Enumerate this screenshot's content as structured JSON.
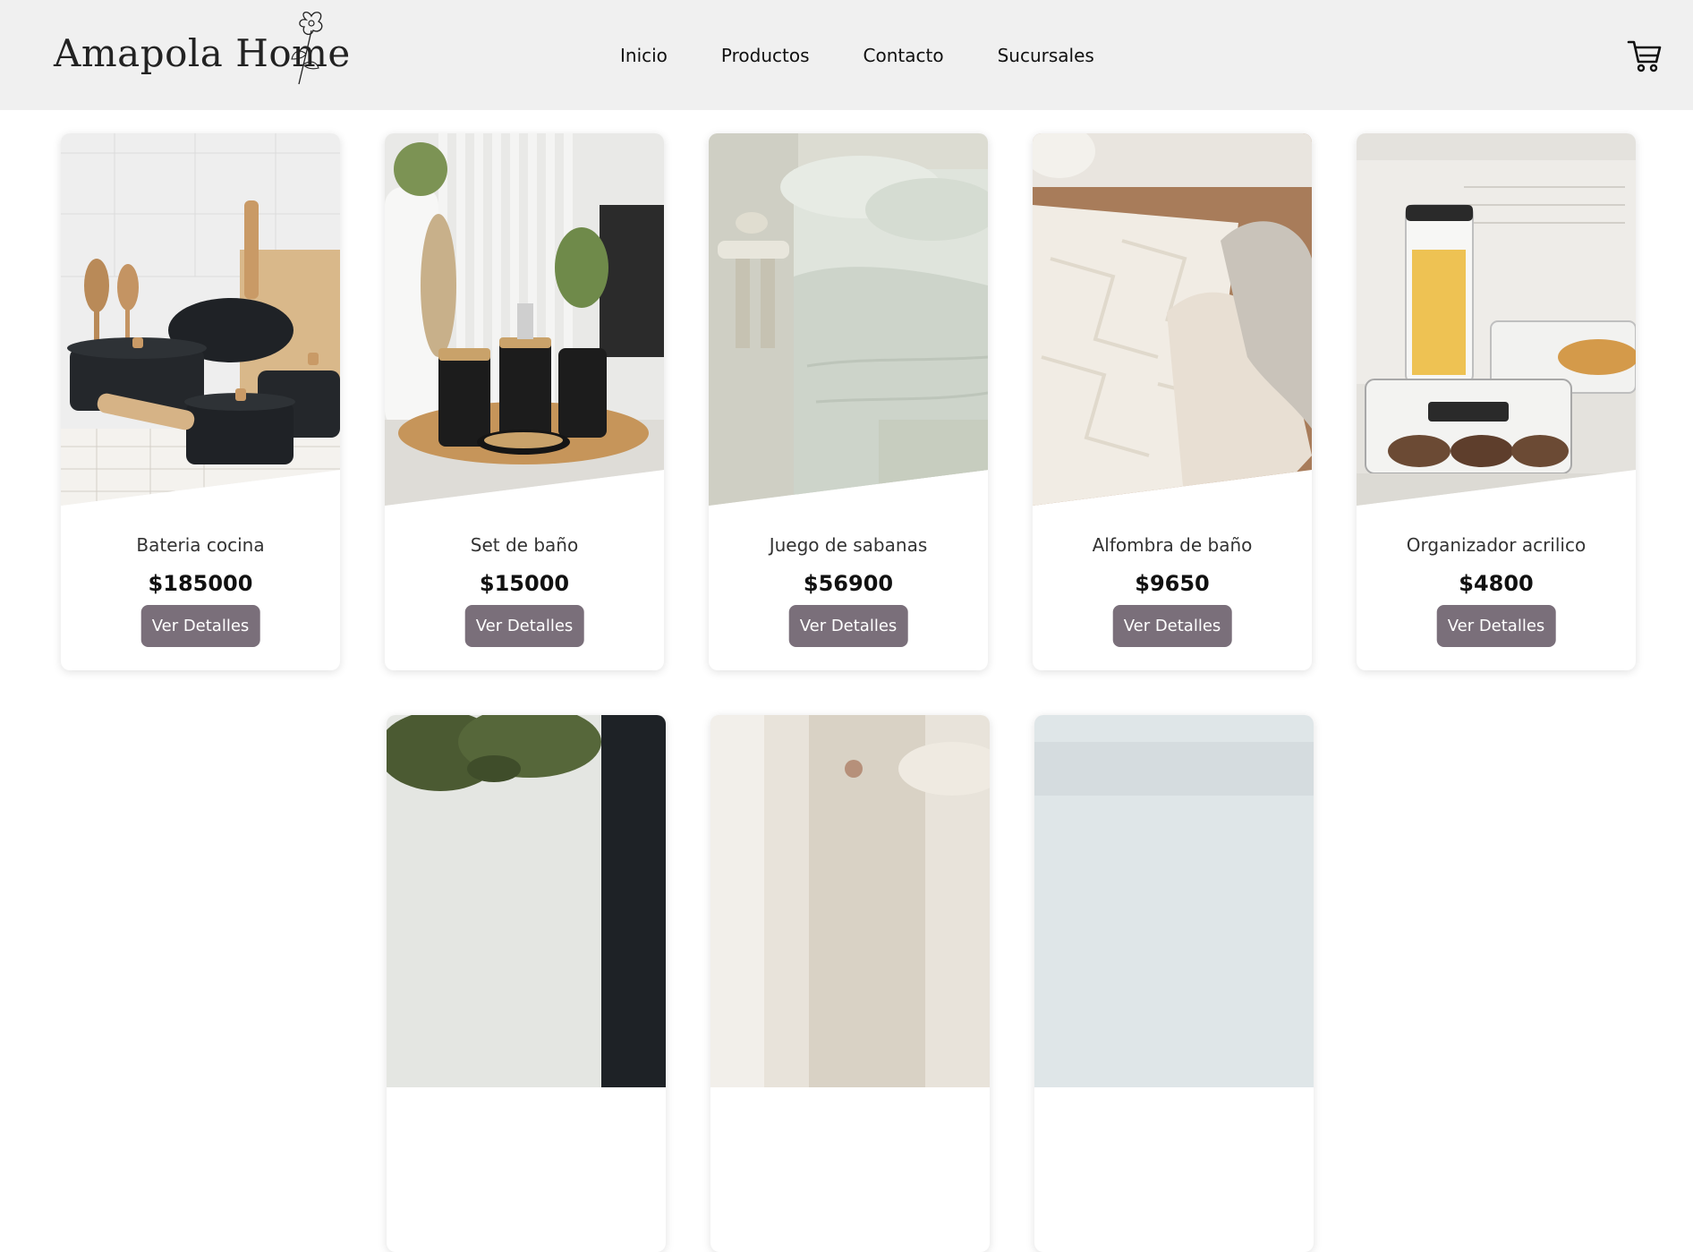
{
  "brand": {
    "name": "Amapola Home"
  },
  "nav": {
    "items": [
      {
        "label": "Inicio"
      },
      {
        "label": "Productos"
      },
      {
        "label": "Contacto"
      },
      {
        "label": "Sucursales"
      }
    ]
  },
  "cart": {
    "icon": "cart-icon"
  },
  "products": [
    {
      "name": "Bateria cocina",
      "price": "$185000",
      "button": "Ver Detalles",
      "image": "cookware-set"
    },
    {
      "name": "Set de baño",
      "price": "$15000",
      "button": "Ver Detalles",
      "image": "bathroom-set"
    },
    {
      "name": "Juego de sabanas",
      "price": "$56900",
      "button": "Ver Detalles",
      "image": "bed-sheets"
    },
    {
      "name": "Alfombra de baño",
      "price": "$9650",
      "button": "Ver Detalles",
      "image": "bath-rug"
    },
    {
      "name": "Organizador acrilico",
      "price": "$4800",
      "button": "Ver Detalles",
      "image": "acrylic-organizer"
    }
  ],
  "colors": {
    "header_bg": "#f0f0f0",
    "button_bg": "#7a6f7a",
    "button_text": "#ffffff"
  }
}
